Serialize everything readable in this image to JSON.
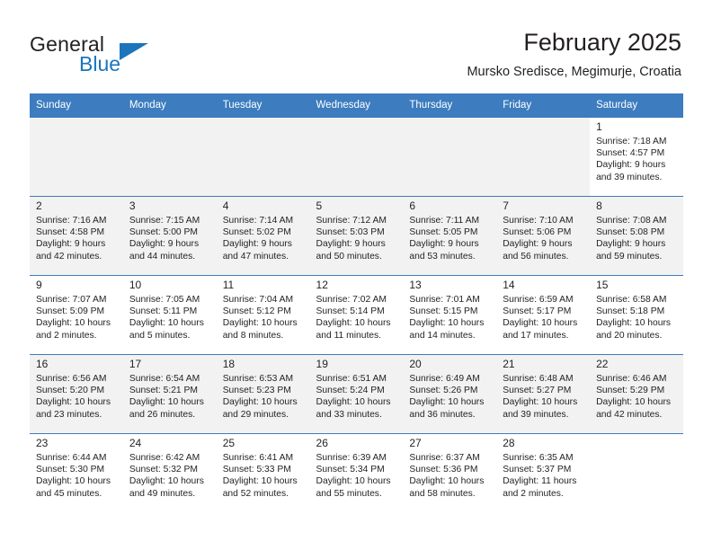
{
  "brand": {
    "name_primary": "General",
    "name_secondary": "Blue",
    "logo_icon": "triangle-logo-icon",
    "accent_color": "#1b75bb"
  },
  "header": {
    "title": "February 2025",
    "subtitle": "Mursko Sredisce, Megimurje, Croatia"
  },
  "theme": {
    "header_row_color": "#3c7cbf",
    "shaded_cell_color": "#f2f2f2"
  },
  "calendar": {
    "weekday_headers": [
      "Sunday",
      "Monday",
      "Tuesday",
      "Wednesday",
      "Thursday",
      "Friday",
      "Saturday"
    ],
    "weeks": [
      [
        {
          "day": "",
          "detail": "",
          "shaded": true,
          "empty": true
        },
        {
          "day": "",
          "detail": "",
          "shaded": true,
          "empty": true
        },
        {
          "day": "",
          "detail": "",
          "shaded": true,
          "empty": true
        },
        {
          "day": "",
          "detail": "",
          "shaded": true,
          "empty": true
        },
        {
          "day": "",
          "detail": "",
          "shaded": true,
          "empty": true
        },
        {
          "day": "",
          "detail": "",
          "shaded": true,
          "empty": true
        },
        {
          "day": "1",
          "detail": "Sunrise: 7:18 AM\nSunset: 4:57 PM\nDaylight: 9 hours\nand 39 minutes.",
          "shaded": false,
          "empty": false
        }
      ],
      [
        {
          "day": "2",
          "detail": "Sunrise: 7:16 AM\nSunset: 4:58 PM\nDaylight: 9 hours\nand 42 minutes.",
          "shaded": true,
          "empty": false
        },
        {
          "day": "3",
          "detail": "Sunrise: 7:15 AM\nSunset: 5:00 PM\nDaylight: 9 hours\nand 44 minutes.",
          "shaded": true,
          "empty": false
        },
        {
          "day": "4",
          "detail": "Sunrise: 7:14 AM\nSunset: 5:02 PM\nDaylight: 9 hours\nand 47 minutes.",
          "shaded": true,
          "empty": false
        },
        {
          "day": "5",
          "detail": "Sunrise: 7:12 AM\nSunset: 5:03 PM\nDaylight: 9 hours\nand 50 minutes.",
          "shaded": true,
          "empty": false
        },
        {
          "day": "6",
          "detail": "Sunrise: 7:11 AM\nSunset: 5:05 PM\nDaylight: 9 hours\nand 53 minutes.",
          "shaded": true,
          "empty": false
        },
        {
          "day": "7",
          "detail": "Sunrise: 7:10 AM\nSunset: 5:06 PM\nDaylight: 9 hours\nand 56 minutes.",
          "shaded": true,
          "empty": false
        },
        {
          "day": "8",
          "detail": "Sunrise: 7:08 AM\nSunset: 5:08 PM\nDaylight: 9 hours\nand 59 minutes.",
          "shaded": true,
          "empty": false
        }
      ],
      [
        {
          "day": "9",
          "detail": "Sunrise: 7:07 AM\nSunset: 5:09 PM\nDaylight: 10 hours\nand 2 minutes.",
          "shaded": false,
          "empty": false
        },
        {
          "day": "10",
          "detail": "Sunrise: 7:05 AM\nSunset: 5:11 PM\nDaylight: 10 hours\nand 5 minutes.",
          "shaded": false,
          "empty": false
        },
        {
          "day": "11",
          "detail": "Sunrise: 7:04 AM\nSunset: 5:12 PM\nDaylight: 10 hours\nand 8 minutes.",
          "shaded": false,
          "empty": false
        },
        {
          "day": "12",
          "detail": "Sunrise: 7:02 AM\nSunset: 5:14 PM\nDaylight: 10 hours\nand 11 minutes.",
          "shaded": false,
          "empty": false
        },
        {
          "day": "13",
          "detail": "Sunrise: 7:01 AM\nSunset: 5:15 PM\nDaylight: 10 hours\nand 14 minutes.",
          "shaded": false,
          "empty": false
        },
        {
          "day": "14",
          "detail": "Sunrise: 6:59 AM\nSunset: 5:17 PM\nDaylight: 10 hours\nand 17 minutes.",
          "shaded": false,
          "empty": false
        },
        {
          "day": "15",
          "detail": "Sunrise: 6:58 AM\nSunset: 5:18 PM\nDaylight: 10 hours\nand 20 minutes.",
          "shaded": false,
          "empty": false
        }
      ],
      [
        {
          "day": "16",
          "detail": "Sunrise: 6:56 AM\nSunset: 5:20 PM\nDaylight: 10 hours\nand 23 minutes.",
          "shaded": true,
          "empty": false
        },
        {
          "day": "17",
          "detail": "Sunrise: 6:54 AM\nSunset: 5:21 PM\nDaylight: 10 hours\nand 26 minutes.",
          "shaded": true,
          "empty": false
        },
        {
          "day": "18",
          "detail": "Sunrise: 6:53 AM\nSunset: 5:23 PM\nDaylight: 10 hours\nand 29 minutes.",
          "shaded": true,
          "empty": false
        },
        {
          "day": "19",
          "detail": "Sunrise: 6:51 AM\nSunset: 5:24 PM\nDaylight: 10 hours\nand 33 minutes.",
          "shaded": true,
          "empty": false
        },
        {
          "day": "20",
          "detail": "Sunrise: 6:49 AM\nSunset: 5:26 PM\nDaylight: 10 hours\nand 36 minutes.",
          "shaded": true,
          "empty": false
        },
        {
          "day": "21",
          "detail": "Sunrise: 6:48 AM\nSunset: 5:27 PM\nDaylight: 10 hours\nand 39 minutes.",
          "shaded": true,
          "empty": false
        },
        {
          "day": "22",
          "detail": "Sunrise: 6:46 AM\nSunset: 5:29 PM\nDaylight: 10 hours\nand 42 minutes.",
          "shaded": true,
          "empty": false
        }
      ],
      [
        {
          "day": "23",
          "detail": "Sunrise: 6:44 AM\nSunset: 5:30 PM\nDaylight: 10 hours\nand 45 minutes.",
          "shaded": false,
          "empty": false
        },
        {
          "day": "24",
          "detail": "Sunrise: 6:42 AM\nSunset: 5:32 PM\nDaylight: 10 hours\nand 49 minutes.",
          "shaded": false,
          "empty": false
        },
        {
          "day": "25",
          "detail": "Sunrise: 6:41 AM\nSunset: 5:33 PM\nDaylight: 10 hours\nand 52 minutes.",
          "shaded": false,
          "empty": false
        },
        {
          "day": "26",
          "detail": "Sunrise: 6:39 AM\nSunset: 5:34 PM\nDaylight: 10 hours\nand 55 minutes.",
          "shaded": false,
          "empty": false
        },
        {
          "day": "27",
          "detail": "Sunrise: 6:37 AM\nSunset: 5:36 PM\nDaylight: 10 hours\nand 58 minutes.",
          "shaded": false,
          "empty": false
        },
        {
          "day": "28",
          "detail": "Sunrise: 6:35 AM\nSunset: 5:37 PM\nDaylight: 11 hours\nand 2 minutes.",
          "shaded": false,
          "empty": false
        },
        {
          "day": "",
          "detail": "",
          "shaded": false,
          "empty": true
        }
      ]
    ]
  }
}
